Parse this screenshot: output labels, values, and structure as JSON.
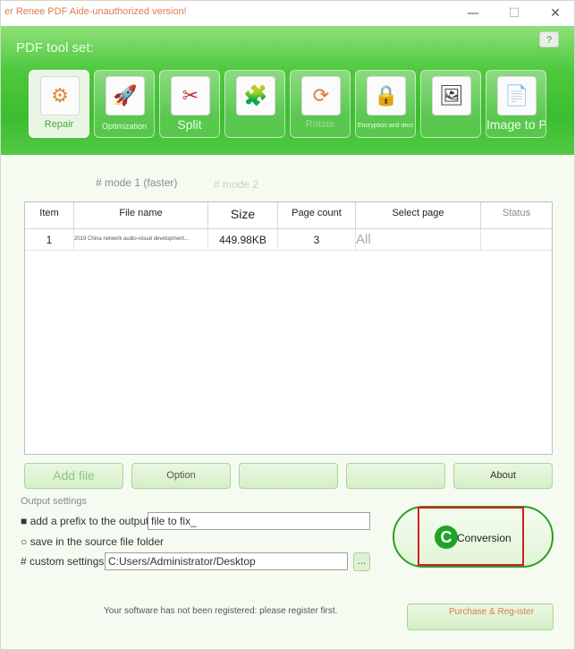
{
  "window": {
    "title": "er Renee PDF Aide-unauthorized version!",
    "minimize": "—",
    "maximize": "☐",
    "close": "✕"
  },
  "header": {
    "toolset_label": "PDF tool set:",
    "help_icon": "?",
    "tools": [
      {
        "label": "Repair",
        "icon": "repair-icon",
        "glyph": "⚙"
      },
      {
        "label": "Optimization",
        "icon": "rocket-icon",
        "glyph": "🚀"
      },
      {
        "label": "Split",
        "icon": "scissors-icon",
        "glyph": "✂"
      },
      {
        "label": "",
        "icon": "merge-puzzle-icon",
        "glyph": "🧩"
      },
      {
        "label": "Rotate",
        "icon": "rotate-icon",
        "glyph": "⟳"
      },
      {
        "label": "Encryption and decr",
        "icon": "lock-folder-icon",
        "glyph": "🔒"
      },
      {
        "label": "",
        "icon": "image-icon",
        "glyph": "🖼"
      },
      {
        "label": "Image to PDF",
        "icon": "jpg-to-pdf-icon",
        "glyph": "📄"
      }
    ]
  },
  "mode": {
    "ghost_label": "",
    "mode1": "# mode 1 (faster)",
    "mode2": "# mode 2"
  },
  "table": {
    "columns": [
      "Item",
      "File name",
      "Size",
      "Page count",
      "Select page",
      "Status"
    ],
    "rows": [
      {
        "item": "1",
        "file_name": "2019 China network audio-visual development...",
        "size": "449.98KB",
        "page_count": "3",
        "select_page": "All",
        "status": ""
      }
    ]
  },
  "actions": {
    "add_file": "Add file",
    "option": "Option",
    "btn3": "",
    "btn4": "",
    "about": "About"
  },
  "output": {
    "label": "Output settings",
    "prefix_option": "■ add a prefix to the output",
    "prefix_value": "file to fix_",
    "source_option": "○ save in the source file folder",
    "custom_option": "# custom settings",
    "custom_path": "C:Users/Administrator/Desktop",
    "browse": "..."
  },
  "convert": {
    "label": "Conversion",
    "icon": "C"
  },
  "footer": {
    "notice": "Your software has not been registered: please register first.",
    "register": "Purchase & Reg-ister"
  },
  "colors": {
    "brand_green": "#3cbd30",
    "highlight_red": "#d02020",
    "title_orange": "#e07a4f"
  }
}
